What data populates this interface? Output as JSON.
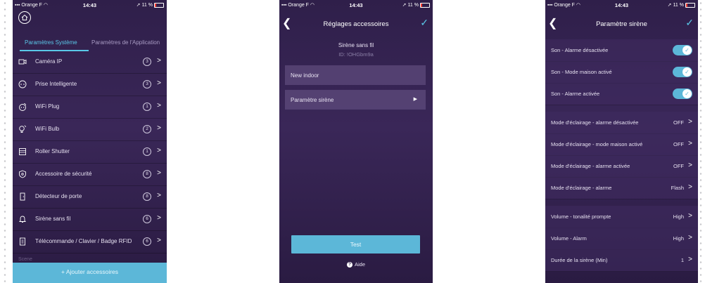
{
  "status": {
    "carrier": "Orange F",
    "time": "14:43",
    "battery": "11 %"
  },
  "screen1": {
    "tabs": [
      "Paramètres Système",
      "Paramètres de l'Application"
    ],
    "items": [
      {
        "label": "Caméra IP",
        "count": "3",
        "icon": "camera-icon"
      },
      {
        "label": "Prise Intelligente",
        "count": "3",
        "icon": "plug-icon"
      },
      {
        "label": "WiFi Plug",
        "count": "1",
        "icon": "wifi-plug-icon"
      },
      {
        "label": "WiFi Bulb",
        "count": "2",
        "icon": "bulb-icon"
      },
      {
        "label": "Roller Shutter",
        "count": "1",
        "icon": "shutter-icon"
      },
      {
        "label": "Accessoire de sécurité",
        "count": "8",
        "icon": "shield-icon"
      },
      {
        "label": "Détecteur de porte",
        "count": "8",
        "icon": "door-icon"
      },
      {
        "label": "Sirène sans fil",
        "count": "6",
        "icon": "bell-icon"
      },
      {
        "label": "Télécommande / Clavier / Badge RFID",
        "count": "6",
        "icon": "remote-icon"
      }
    ],
    "scene_label": "Scene",
    "add_button": "+  Ajouter accessoires"
  },
  "screen2": {
    "title": "Réglages accessoires",
    "device_name": "Sirène sans fil",
    "device_id": "ID: !OHGbm9a",
    "name_field": "New indoor",
    "siren_param": "Paramètre sirène",
    "test_button": "Test",
    "help": "Aide"
  },
  "screen3": {
    "title": "Paramètre sirène",
    "toggles": [
      {
        "label": "Son - Alarme désactivée",
        "on": true
      },
      {
        "label": "Son - Mode maison activé",
        "on": true
      },
      {
        "label": "Son - Alarme activée",
        "on": true
      }
    ],
    "lighting": [
      {
        "label": "Mode d'éclairage - alarme désactivée",
        "value": "OFF"
      },
      {
        "label": "Mode d'éclairage - mode maison activé",
        "value": "OFF"
      },
      {
        "label": "Mode d'éclairage - alarme activée",
        "value": "OFF"
      },
      {
        "label": "Mode d'éclairage - alarme",
        "value": "Flash"
      }
    ],
    "volume": [
      {
        "label": "Volume - tonalité prompte",
        "value": "High"
      },
      {
        "label": "Volume - Alarm",
        "value": "High"
      },
      {
        "label": "Durée de la sirène (Min)",
        "value": "1"
      }
    ]
  },
  "colors": {
    "accent": "#5cb7d8",
    "background": "#2f1f4a"
  }
}
